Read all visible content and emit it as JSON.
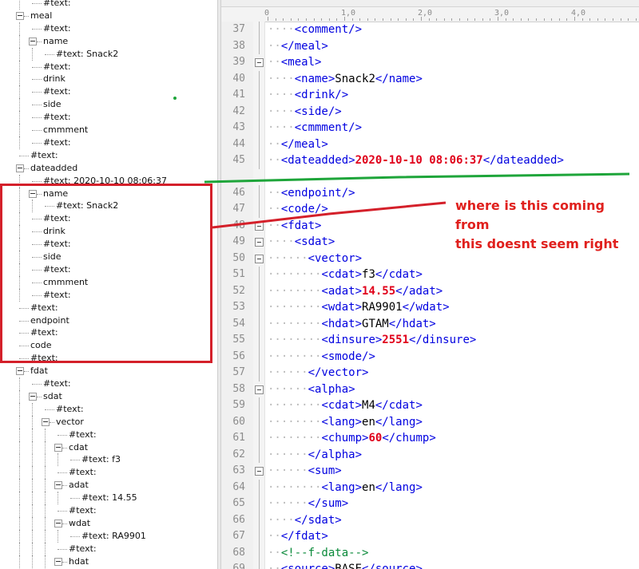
{
  "tree": {
    "rows": [
      {
        "depth": 2,
        "toggle": false,
        "label": "#text:"
      },
      {
        "depth": 1,
        "toggle": true,
        "label": "meal"
      },
      {
        "depth": 2,
        "toggle": false,
        "label": "#text:"
      },
      {
        "depth": 2,
        "toggle": true,
        "label": "name"
      },
      {
        "depth": 3,
        "toggle": false,
        "label": "#text: Snack2"
      },
      {
        "depth": 2,
        "toggle": false,
        "label": "#text:"
      },
      {
        "depth": 2,
        "toggle": false,
        "label": "drink"
      },
      {
        "depth": 2,
        "toggle": false,
        "label": "#text:"
      },
      {
        "depth": 2,
        "toggle": false,
        "label": "side"
      },
      {
        "depth": 2,
        "toggle": false,
        "label": "#text:"
      },
      {
        "depth": 2,
        "toggle": false,
        "label": "cmmment"
      },
      {
        "depth": 2,
        "toggle": false,
        "label": "#text:"
      },
      {
        "depth": 1,
        "toggle": false,
        "label": "#text:"
      },
      {
        "depth": 1,
        "toggle": true,
        "label": "dateadded"
      },
      {
        "depth": 2,
        "toggle": false,
        "label": "#text: 2020-10-10 08:06:37"
      },
      {
        "depth": 2,
        "toggle": true,
        "label": "name"
      },
      {
        "depth": 3,
        "toggle": false,
        "label": "#text: Snack2"
      },
      {
        "depth": 2,
        "toggle": false,
        "label": "#text:"
      },
      {
        "depth": 2,
        "toggle": false,
        "label": "drink"
      },
      {
        "depth": 2,
        "toggle": false,
        "label": "#text:"
      },
      {
        "depth": 2,
        "toggle": false,
        "label": "side"
      },
      {
        "depth": 2,
        "toggle": false,
        "label": "#text:"
      },
      {
        "depth": 2,
        "toggle": false,
        "label": "cmmment"
      },
      {
        "depth": 2,
        "toggle": false,
        "label": "#text:"
      },
      {
        "depth": 1,
        "toggle": false,
        "label": "#text:"
      },
      {
        "depth": 1,
        "toggle": false,
        "label": "endpoint"
      },
      {
        "depth": 1,
        "toggle": false,
        "label": "#text:"
      },
      {
        "depth": 1,
        "toggle": false,
        "label": "code"
      },
      {
        "depth": 1,
        "toggle": false,
        "label": "#text:"
      },
      {
        "depth": 1,
        "toggle": true,
        "label": "fdat"
      },
      {
        "depth": 2,
        "toggle": false,
        "label": "#text:"
      },
      {
        "depth": 2,
        "toggle": true,
        "label": "sdat"
      },
      {
        "depth": 3,
        "toggle": false,
        "label": "#text:"
      },
      {
        "depth": 3,
        "toggle": true,
        "label": "vector"
      },
      {
        "depth": 4,
        "toggle": false,
        "label": "#text:"
      },
      {
        "depth": 4,
        "toggle": true,
        "label": "cdat"
      },
      {
        "depth": 5,
        "toggle": false,
        "label": "#text: f3"
      },
      {
        "depth": 4,
        "toggle": false,
        "label": "#text:"
      },
      {
        "depth": 4,
        "toggle": true,
        "label": "adat"
      },
      {
        "depth": 5,
        "toggle": false,
        "label": "#text: 14.55"
      },
      {
        "depth": 4,
        "toggle": false,
        "label": "#text:"
      },
      {
        "depth": 4,
        "toggle": true,
        "label": "wdat"
      },
      {
        "depth": 5,
        "toggle": false,
        "label": "#text: RA9901"
      },
      {
        "depth": 4,
        "toggle": false,
        "label": "#text:"
      },
      {
        "depth": 4,
        "toggle": true,
        "label": "hdat"
      }
    ]
  },
  "ruler": {
    "labels": [
      "0",
      "1,0",
      "2,0",
      "3,0",
      "4,0"
    ]
  },
  "editor": {
    "lines": [
      {
        "n": "37",
        "indent": 2,
        "fold": "line",
        "parts": [
          [
            "tag",
            "<comment/>"
          ]
        ]
      },
      {
        "n": "38",
        "indent": 1,
        "fold": "line",
        "parts": [
          [
            "tag",
            "</meal>"
          ]
        ]
      },
      {
        "n": "39",
        "indent": 1,
        "fold": "box",
        "parts": [
          [
            "tag",
            "<meal>"
          ]
        ]
      },
      {
        "n": "40",
        "indent": 2,
        "fold": "line",
        "parts": [
          [
            "tag",
            "<name>"
          ],
          [
            "txt",
            "Snack2"
          ],
          [
            "tag",
            "</name>"
          ]
        ]
      },
      {
        "n": "41",
        "indent": 2,
        "fold": "line",
        "parts": [
          [
            "tag",
            "<drink/>"
          ]
        ]
      },
      {
        "n": "42",
        "indent": 2,
        "fold": "line",
        "parts": [
          [
            "tag",
            "<side/>"
          ]
        ]
      },
      {
        "n": "43",
        "indent": 2,
        "fold": "line",
        "parts": [
          [
            "tag",
            "<cmmment/>"
          ]
        ]
      },
      {
        "n": "44",
        "indent": 1,
        "fold": "line",
        "parts": [
          [
            "tag",
            "</meal>"
          ]
        ]
      },
      {
        "n": "45",
        "indent": 1,
        "fold": "line",
        "parts": [
          [
            "tag",
            "<dateadded>"
          ],
          [
            "num",
            "2020-10-10 08:06:37"
          ],
          [
            "tag",
            "</dateadded>"
          ]
        ]
      },
      {
        "n": "46",
        "indent": 1,
        "fold": "line",
        "parts": [
          [
            "tag",
            "<endpoint/>"
          ]
        ]
      },
      {
        "n": "47",
        "indent": 1,
        "fold": "line",
        "parts": [
          [
            "tag",
            "<code/>"
          ]
        ]
      },
      {
        "n": "48",
        "indent": 1,
        "fold": "box",
        "parts": [
          [
            "tag",
            "<fdat>"
          ]
        ]
      },
      {
        "n": "49",
        "indent": 2,
        "fold": "box",
        "parts": [
          [
            "tag",
            "<sdat>"
          ]
        ]
      },
      {
        "n": "50",
        "indent": 3,
        "fold": "box",
        "parts": [
          [
            "tag",
            "<vector>"
          ]
        ]
      },
      {
        "n": "51",
        "indent": 4,
        "fold": "line",
        "parts": [
          [
            "tag",
            "<cdat>"
          ],
          [
            "txt",
            "f3"
          ],
          [
            "tag",
            "</cdat>"
          ]
        ]
      },
      {
        "n": "52",
        "indent": 4,
        "fold": "line",
        "parts": [
          [
            "tag",
            "<adat>"
          ],
          [
            "num",
            "14.55"
          ],
          [
            "tag",
            "</adat>"
          ]
        ]
      },
      {
        "n": "53",
        "indent": 4,
        "fold": "line",
        "parts": [
          [
            "tag",
            "<wdat>"
          ],
          [
            "txt",
            "RA9901"
          ],
          [
            "tag",
            "</wdat>"
          ]
        ]
      },
      {
        "n": "54",
        "indent": 4,
        "fold": "line",
        "parts": [
          [
            "tag",
            "<hdat>"
          ],
          [
            "txt",
            "GTAM"
          ],
          [
            "tag",
            "</hdat>"
          ]
        ]
      },
      {
        "n": "55",
        "indent": 4,
        "fold": "line",
        "parts": [
          [
            "tag",
            "<dinsure>"
          ],
          [
            "num",
            "2551"
          ],
          [
            "tag",
            "</dinsure>"
          ]
        ]
      },
      {
        "n": "56",
        "indent": 4,
        "fold": "line",
        "parts": [
          [
            "tag",
            "<smode/>"
          ]
        ]
      },
      {
        "n": "57",
        "indent": 3,
        "fold": "line",
        "parts": [
          [
            "tag",
            "</vector>"
          ]
        ]
      },
      {
        "n": "58",
        "indent": 3,
        "fold": "box",
        "parts": [
          [
            "tag",
            "<alpha>"
          ]
        ]
      },
      {
        "n": "59",
        "indent": 4,
        "fold": "line",
        "parts": [
          [
            "tag",
            "<cdat>"
          ],
          [
            "txt",
            "M4"
          ],
          [
            "tag",
            "</cdat>"
          ]
        ]
      },
      {
        "n": "60",
        "indent": 4,
        "fold": "line",
        "parts": [
          [
            "tag",
            "<lang>"
          ],
          [
            "txt",
            "en"
          ],
          [
            "tag",
            "</lang>"
          ]
        ]
      },
      {
        "n": "61",
        "indent": 4,
        "fold": "line",
        "parts": [
          [
            "tag",
            "<chump>"
          ],
          [
            "num",
            "60"
          ],
          [
            "tag",
            "</chump>"
          ]
        ]
      },
      {
        "n": "62",
        "indent": 3,
        "fold": "line",
        "parts": [
          [
            "tag",
            "</alpha>"
          ]
        ]
      },
      {
        "n": "63",
        "indent": 3,
        "fold": "box",
        "parts": [
          [
            "tag",
            "<sum>"
          ]
        ]
      },
      {
        "n": "64",
        "indent": 4,
        "fold": "line",
        "parts": [
          [
            "tag",
            "<lang>"
          ],
          [
            "txt",
            "en"
          ],
          [
            "tag",
            "</lang>"
          ]
        ]
      },
      {
        "n": "65",
        "indent": 3,
        "fold": "line",
        "parts": [
          [
            "tag",
            "</sum>"
          ]
        ]
      },
      {
        "n": "66",
        "indent": 2,
        "fold": "line",
        "parts": [
          [
            "tag",
            "</sdat>"
          ]
        ]
      },
      {
        "n": "67",
        "indent": 1,
        "fold": "line",
        "parts": [
          [
            "tag",
            "</fdat>"
          ]
        ]
      },
      {
        "n": "68",
        "indent": 1,
        "fold": "line",
        "parts": [
          [
            "cmt",
            "<!--f-data-->"
          ]
        ]
      },
      {
        "n": "69",
        "indent": 1,
        "fold": "line",
        "parts": [
          [
            "tag",
            "<source>"
          ],
          [
            "txt",
            "BASE"
          ],
          [
            "tag",
            "</source>"
          ]
        ]
      }
    ]
  },
  "annotation": {
    "line1": "where is this coming from",
    "line2": "this doesnt seem right"
  },
  "colors": {
    "tag": "#0000e0",
    "number_value": "#e0001a",
    "comment": "#0a8a3a",
    "annotation_red": "#d4202a",
    "annotation_green": "#1ea53a"
  }
}
